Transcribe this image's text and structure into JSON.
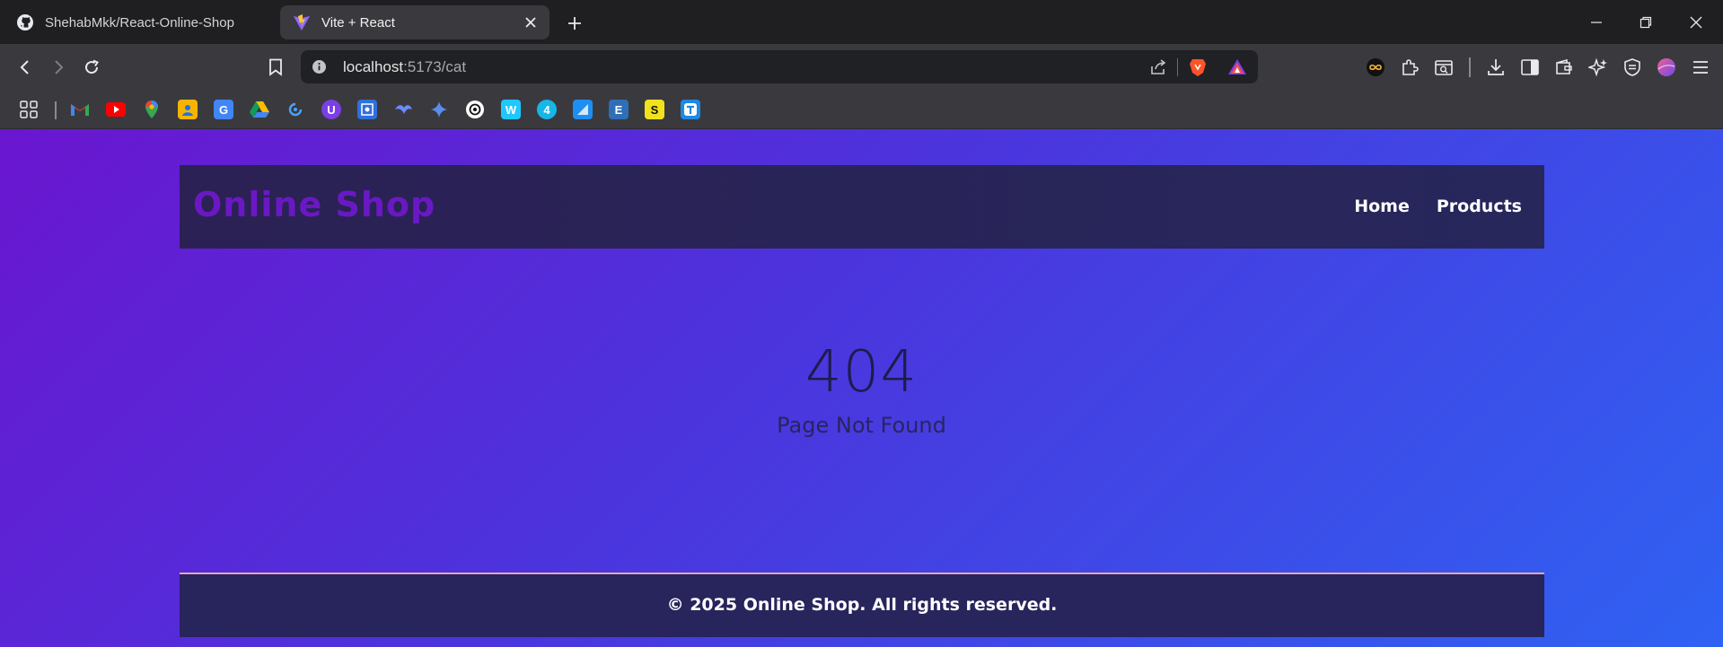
{
  "browser": {
    "tabs": [
      {
        "title": "ShehabMkk/React-Online-Shop",
        "icon": "github-icon",
        "active": false
      },
      {
        "title": "Vite + React",
        "icon": "vite-icon",
        "active": true
      }
    ],
    "address": {
      "host": "localhost",
      "port_path": ":5173/cat"
    }
  },
  "page": {
    "logo": "Online Shop",
    "nav": [
      {
        "label": "Home"
      },
      {
        "label": "Products"
      }
    ],
    "error_code": "404",
    "error_message": "Page Not Found",
    "footer": "© 2025 Online Shop. All rights reserved."
  },
  "colors": {
    "gradient_start": "#6a16cf",
    "gradient_end": "#2f62f2",
    "header_bg": "#2b2154",
    "logo": "#6a18c4",
    "footer_border": "#e7a6b8"
  }
}
